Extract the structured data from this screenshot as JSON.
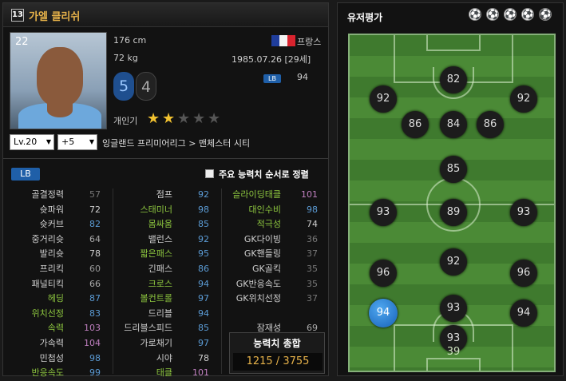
{
  "player": {
    "number": "13",
    "name": "가엘 클리쉬",
    "ovr_small": "22",
    "height": "176 cm",
    "weight": "72 kg",
    "nation": "프랑스",
    "birth": "1985.07.26 [29세]",
    "position": "LB",
    "position_ovr": "94",
    "weak_foot_left": "5",
    "weak_foot_right": "4",
    "popularity_label": "개인기",
    "skill_stars": 2,
    "skill_stars_max": 5,
    "level": "Lv.20",
    "plus": "+5",
    "club": "잉글랜드 프리미어리그 > 맨체스터 시티"
  },
  "stats_header": {
    "position_tag": "LB",
    "sort_label": "주요 능력치 순서로 정렬"
  },
  "stats": {
    "col1": [
      {
        "label": "골결정력",
        "value": "57",
        "lc": "#cfcfcf",
        "vc": "#777777"
      },
      {
        "label": "슛파워",
        "value": "72",
        "lc": "#cfcfcf",
        "vc": "#cfcfcf"
      },
      {
        "label": "슛커브",
        "value": "82",
        "lc": "#cfcfcf",
        "vc": "#5b9bd5"
      },
      {
        "label": "중거리슛",
        "value": "64",
        "lc": "#cfcfcf",
        "vc": "#aaaaaa"
      },
      {
        "label": "발리슛",
        "value": "78",
        "lc": "#cfcfcf",
        "vc": "#cfcfcf"
      },
      {
        "label": "프리킥",
        "value": "60",
        "lc": "#cfcfcf",
        "vc": "#999999"
      },
      {
        "label": "패널티킥",
        "value": "66",
        "lc": "#cfcfcf",
        "vc": "#aaaaaa"
      },
      {
        "label": "헤딩",
        "value": "87",
        "lc": "#8dc63f",
        "vc": "#5b9bd5"
      },
      {
        "label": "위치선정",
        "value": "83",
        "lc": "#8dc63f",
        "vc": "#5b9bd5"
      },
      {
        "label": "속력",
        "value": "103",
        "lc": "#8dc63f",
        "vc": "#c080c0"
      },
      {
        "label": "가속력",
        "value": "104",
        "lc": "#cfcfcf",
        "vc": "#c080c0"
      },
      {
        "label": "민첩성",
        "value": "98",
        "lc": "#cfcfcf",
        "vc": "#5b9bd5"
      },
      {
        "label": "반응속도",
        "value": "99",
        "lc": "#8dc63f",
        "vc": "#5b9bd5"
      }
    ],
    "col2": [
      {
        "label": "점프",
        "value": "92",
        "lc": "#cfcfcf",
        "vc": "#5b9bd5"
      },
      {
        "label": "스태미너",
        "value": "98",
        "lc": "#8dc63f",
        "vc": "#5b9bd5"
      },
      {
        "label": "몸싸움",
        "value": "85",
        "lc": "#8dc63f",
        "vc": "#5b9bd5"
      },
      {
        "label": "밸런스",
        "value": "92",
        "lc": "#cfcfcf",
        "vc": "#5b9bd5"
      },
      {
        "label": "짧은패스",
        "value": "95",
        "lc": "#8dc63f",
        "vc": "#5b9bd5"
      },
      {
        "label": "긴패스",
        "value": "86",
        "lc": "#cfcfcf",
        "vc": "#5b9bd5"
      },
      {
        "label": "크로스",
        "value": "94",
        "lc": "#8dc63f",
        "vc": "#5b9bd5"
      },
      {
        "label": "볼컨트롤",
        "value": "97",
        "lc": "#8dc63f",
        "vc": "#5b9bd5"
      },
      {
        "label": "드리블",
        "value": "94",
        "lc": "#cfcfcf",
        "vc": "#5b9bd5"
      },
      {
        "label": "드리블스피드",
        "value": "85",
        "lc": "#cfcfcf",
        "vc": "#5b9bd5"
      },
      {
        "label": "가로채기",
        "value": "97",
        "lc": "#cfcfcf",
        "vc": "#5b9bd5"
      },
      {
        "label": "시야",
        "value": "78",
        "lc": "#cfcfcf",
        "vc": "#cfcfcf"
      },
      {
        "label": "태클",
        "value": "101",
        "lc": "#8dc63f",
        "vc": "#c080c0"
      }
    ],
    "col3": [
      {
        "label": "슬라이딩태클",
        "value": "101",
        "lc": "#8dc63f",
        "vc": "#c080c0"
      },
      {
        "label": "대인수비",
        "value": "98",
        "lc": "#8dc63f",
        "vc": "#5b9bd5"
      },
      {
        "label": "적극성",
        "value": "74",
        "lc": "#8dc63f",
        "vc": "#cfcfcf"
      },
      {
        "label": "GK다이빙",
        "value": "36",
        "lc": "#cfcfcf",
        "vc": "#777777"
      },
      {
        "label": "GK핸들링",
        "value": "37",
        "lc": "#cfcfcf",
        "vc": "#777777"
      },
      {
        "label": "GK골킥",
        "value": "35",
        "lc": "#cfcfcf",
        "vc": "#777777"
      },
      {
        "label": "GK반응속도",
        "value": "35",
        "lc": "#cfcfcf",
        "vc": "#777777"
      },
      {
        "label": "GK위치선정",
        "value": "37",
        "lc": "#cfcfcf",
        "vc": "#777777"
      },
      {
        "label": "",
        "value": "",
        "lc": "#cfcfcf",
        "vc": "#cfcfcf"
      },
      {
        "label": "잠재성",
        "value": "69",
        "lc": "#cfcfcf",
        "vc": "#aaaaaa"
      }
    ]
  },
  "overall": {
    "title": "능력치 총합",
    "value": "1215 /  3755"
  },
  "rating_panel": {
    "title": "유저평가",
    "balls_filled": 4,
    "balls_total": 5
  },
  "positions": [
    {
      "id": "st",
      "value": "82",
      "selected": false
    },
    {
      "id": "lw",
      "value": "92",
      "selected": false
    },
    {
      "id": "rw",
      "value": "92",
      "selected": false
    },
    {
      "id": "lf",
      "value": "86",
      "selected": false
    },
    {
      "id": "cf",
      "value": "84",
      "selected": false
    },
    {
      "id": "rf",
      "value": "86",
      "selected": false
    },
    {
      "id": "cam",
      "value": "85",
      "selected": false
    },
    {
      "id": "lm",
      "value": "93",
      "selected": false
    },
    {
      "id": "cm",
      "value": "89",
      "selected": false
    },
    {
      "id": "rm",
      "value": "93",
      "selected": false
    },
    {
      "id": "cdm",
      "value": "92",
      "selected": false
    },
    {
      "id": "lwb",
      "value": "96",
      "selected": false
    },
    {
      "id": "rwb",
      "value": "96",
      "selected": false
    },
    {
      "id": "lb",
      "value": "94",
      "selected": true
    },
    {
      "id": "cb",
      "value": "93",
      "selected": false
    },
    {
      "id": "rb",
      "value": "94",
      "selected": false
    },
    {
      "id": "sw",
      "value": "93",
      "selected": false
    },
    {
      "id": "gk",
      "value": "39",
      "selected": false
    }
  ]
}
